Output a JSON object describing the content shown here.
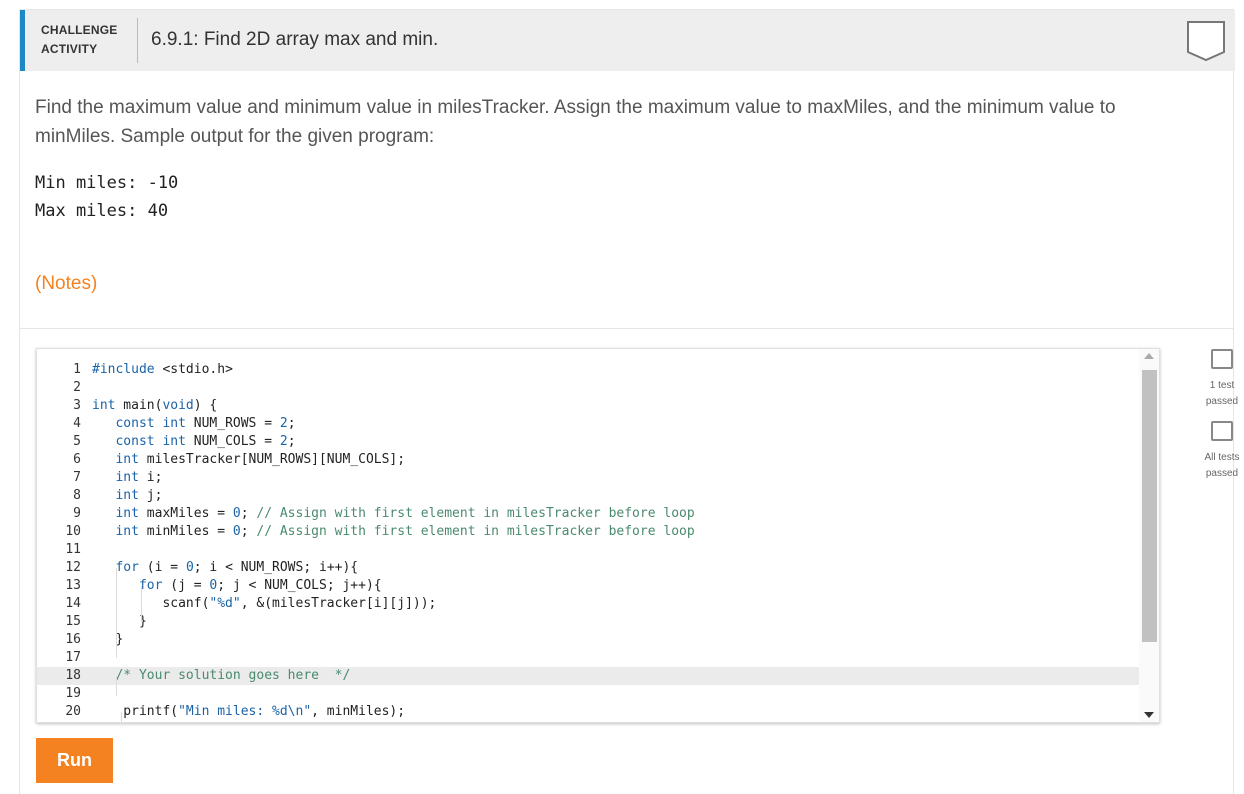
{
  "header": {
    "kind_line1": "CHALLENGE",
    "kind_line2": "ACTIVITY",
    "title": "6.9.1: Find 2D array max and min."
  },
  "prompt": "Find the maximum value and minimum value in milesTracker. Assign the maximum value to maxMiles, and the minimum value to minMiles. Sample output for the given program:",
  "sample_output": [
    "Min miles: -10",
    "Max miles: 40"
  ],
  "notes_label": "(Notes)",
  "code_lines": [
    {
      "n": "1",
      "text": "#include <stdio.h>"
    },
    {
      "n": "2",
      "text": ""
    },
    {
      "n": "3",
      "text": "int main(void) {"
    },
    {
      "n": "4",
      "text": "   const int NUM_ROWS = 2;"
    },
    {
      "n": "5",
      "text": "   const int NUM_COLS = 2;"
    },
    {
      "n": "6",
      "text": "   int milesTracker[NUM_ROWS][NUM_COLS];"
    },
    {
      "n": "7",
      "text": "   int i;"
    },
    {
      "n": "8",
      "text": "   int j;"
    },
    {
      "n": "9",
      "text": "   int maxMiles = 0; // Assign with first element in milesTracker before loop"
    },
    {
      "n": "10",
      "text": "   int minMiles = 0; // Assign with first element in milesTracker before loop"
    },
    {
      "n": "11",
      "text": ""
    },
    {
      "n": "12",
      "text": "   for (i = 0; i < NUM_ROWS; i++){"
    },
    {
      "n": "13",
      "text": "      for (j = 0; j < NUM_COLS; j++){"
    },
    {
      "n": "14",
      "text": "         scanf(\"%d\", &(milesTracker[i][j]));"
    },
    {
      "n": "15",
      "text": "      }"
    },
    {
      "n": "16",
      "text": "   }"
    },
    {
      "n": "17",
      "text": ""
    },
    {
      "n": "18",
      "text": "   /* Your solution goes here  */"
    },
    {
      "n": "19",
      "text": ""
    },
    {
      "n": "20",
      "text": "    printf(\"Min miles: %d\\n\", minMiles);"
    }
  ],
  "active_line": "18",
  "run_label": "Run",
  "tests": [
    {
      "line1": "1 test",
      "line2": "passed"
    },
    {
      "line1": "All tests",
      "line2": "passed"
    }
  ],
  "colors": {
    "accent_blue": "#1c88c7",
    "run_orange": "#f58220",
    "notes_orange": "#f58220"
  }
}
